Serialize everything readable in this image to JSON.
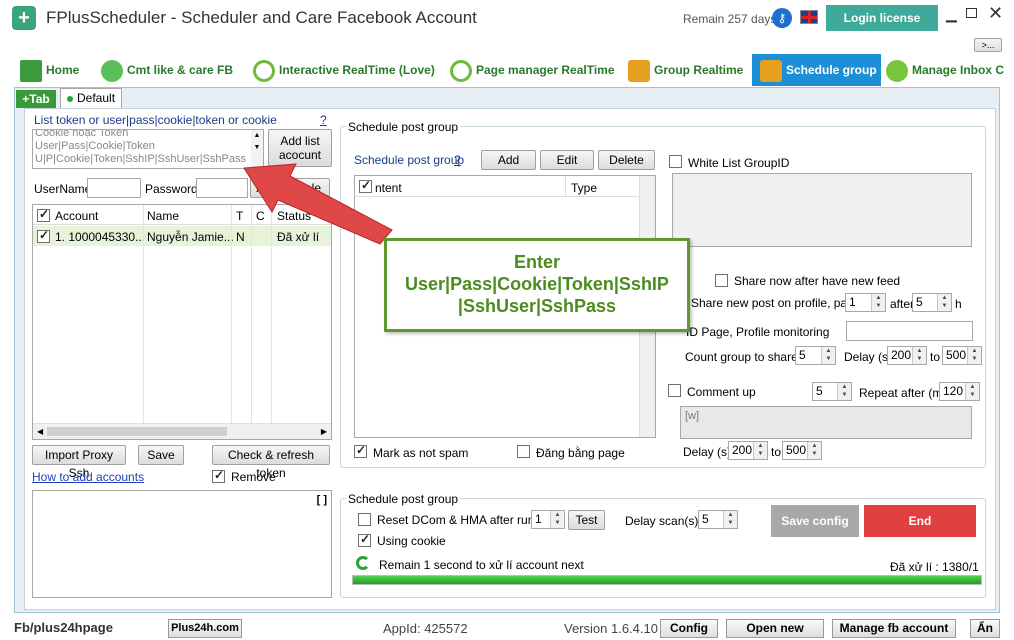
{
  "window": {
    "title": "FPlusScheduler - Scheduler and Care Facebook Account",
    "remain": "Remain 257 days",
    "login_label": "Login license",
    "more_label": ">..."
  },
  "tabs": [
    {
      "label": "Home"
    },
    {
      "label": "Cmt like & care FB"
    },
    {
      "label": "Interactive RealTime (Love)"
    },
    {
      "label": "Page manager RealTime"
    },
    {
      "label": "Group Realtime"
    },
    {
      "label": "Schedule group"
    },
    {
      "label": "Manage Inbox C"
    }
  ],
  "subtabs": {
    "add": "+Tab",
    "default": "Default"
  },
  "left": {
    "token_label": "List token or user|pass|cookie|token or cookie",
    "help": "?",
    "token_lines": [
      "Cookie hoặc Token",
      "User|Pass|Cookie|Token",
      "U|P|Cookie|Token|SshIP|SshUser|SshPass"
    ],
    "add_list_label": "Add list acocunt",
    "username_label": "UserName",
    "password_label": "Password",
    "add_label": "Add",
    "sel_label": "Sele",
    "columns": [
      "Account",
      "Name",
      "T",
      "C",
      "Status"
    ],
    "rows": [
      {
        "account": "1. 1000045330...",
        "name": "Nguyễn Jamie...",
        "t": "N",
        "c": "",
        "status": "Đã xử lí"
      }
    ],
    "import_proxy": "Import Proxy Ssh",
    "save": "Save",
    "check_refresh": "Check & refresh token",
    "how_to": "How to add accounts",
    "remove": "Remove",
    "log_btn": "[ ]"
  },
  "schedule": {
    "group_title": "Schedule post group",
    "post_group_label": "Schedule post group",
    "help": "?",
    "add": "Add",
    "edit": "Edit",
    "delete": "Delete",
    "col_content": "ntent",
    "col_type": "Type",
    "mark_spam": "Mark as not spam",
    "dang_bang_page": "Đăng bằng page",
    "whitelist_label": "White List GroupID",
    "share_now": "Share now after have new feed",
    "share_profile": "Share new post on profile, page",
    "share_val": "1",
    "after_label": "after",
    "after_val": "5",
    "h_label": "h",
    "id_page": "ID Page, Profile monitoring",
    "count_group": "Count group to share",
    "count_val": "5",
    "delay_label": "Delay (s)",
    "delay_from": "200",
    "to_label": "to",
    "delay_to": "500",
    "comment_up": "Comment up",
    "comment_val": "5",
    "repeat_label": "Repeat after (m)",
    "repeat_val": "120",
    "comment_text": "[w]",
    "delay2_label": "Delay (s)",
    "delay2_from": "200",
    "delay2_to": "500"
  },
  "bottom_group": {
    "title": "Schedule post group",
    "reset_dcom": "Reset DCom & HMA after runned",
    "reset_val": "1",
    "test": "Test",
    "delay_scan": "Delay scan(s)",
    "delay_scan_val": "5",
    "using_cookie": "Using cookie",
    "save_config": "Save config",
    "end": "End",
    "remain_text": "Remain 1 second to xử lí account next",
    "processed": "Đã xử lí : 1380/1"
  },
  "callout": {
    "line1": "Enter",
    "line2": "User|Pass|Cookie|Token|SshIP",
    "line3": "|SshUser|SshPass"
  },
  "status_bar": {
    "fb_page": "Fb/plus24hpage",
    "site": "Plus24h.com",
    "appid": "AppId: 425572",
    "version": "Version 1.6.4.10",
    "config": "Config",
    "open_new": "Open new wind...",
    "manage_fb": "Manage fb account",
    "an": "Ẩn"
  },
  "colors": {
    "accent_green": "#2a7a2a",
    "login_bg": "#3daa9a",
    "active_tab": "#1d8fd6",
    "end_red": "#e04040",
    "save_gray": "#a8a8a8",
    "callout_border": "#5c9a2e"
  }
}
